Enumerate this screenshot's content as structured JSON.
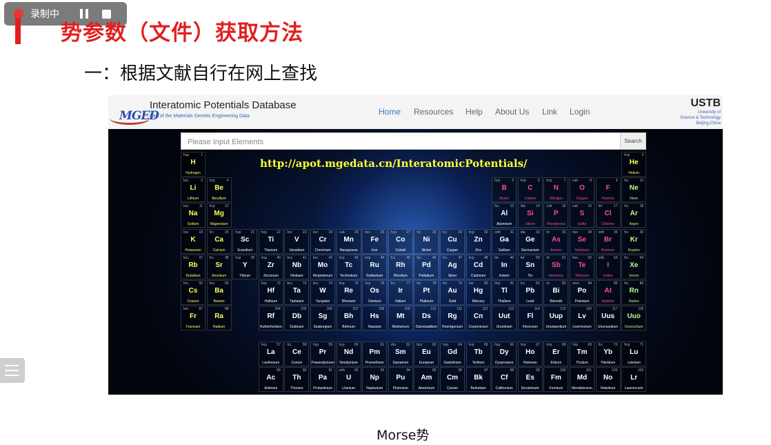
{
  "recorder": {
    "label": "录制中"
  },
  "slide": {
    "title": "势参数（文件）获取方法",
    "subtitle": "一：根据文献自行在网上查找",
    "caption": "Morse势"
  },
  "site": {
    "logo": "MGED",
    "title": "Interatomic Potentials Database",
    "subtitle": "Part of the Materials Genetic Engineering Data",
    "nav": [
      "Home",
      "Resources",
      "Help",
      "About Us",
      "Link",
      "Login"
    ],
    "org": "USTB",
    "org_sub1": "University of",
    "org_sub2": "Science & Technology",
    "org_sub3": "Beijing,China",
    "search_placeholder": "Please Input Elements",
    "search_button": "Search",
    "url": "http://apot.mgedata.cn/InteratomicPotentials/"
  },
  "colors": {
    "accent_red": "#e02020",
    "nav_active": "#3a78c8",
    "url_yellow": "#ffff33"
  },
  "elements": [
    {
      "s": "H",
      "n": "Hydrogen",
      "z": 1,
      "st": "hcp",
      "r": 1,
      "c": 1
    },
    {
      "s": "He",
      "n": "Helium",
      "z": 2,
      "st": "hcp",
      "r": 1,
      "c": 18
    },
    {
      "s": "Li",
      "n": "Lithium",
      "z": 3,
      "st": "bcc",
      "r": 2,
      "c": 1
    },
    {
      "s": "Be",
      "n": "Beryllium",
      "z": 4,
      "st": "hcp",
      "r": 2,
      "c": 2
    },
    {
      "s": "B",
      "n": "Boron",
      "z": 5,
      "st": "hcp",
      "r": 2,
      "c": 13
    },
    {
      "s": "C",
      "n": "Carbon",
      "z": 6,
      "st": "hcp",
      "r": 2,
      "c": 14
    },
    {
      "s": "N",
      "n": "Nitrogen",
      "z": 7,
      "st": "hcp",
      "r": 2,
      "c": 15
    },
    {
      "s": "O",
      "n": "Oxygen",
      "z": 8,
      "st": "cub",
      "r": 2,
      "c": 16
    },
    {
      "s": "F",
      "n": "Fluorine",
      "z": 9,
      "st": "",
      "r": 2,
      "c": 17
    },
    {
      "s": "Ne",
      "n": "Neon",
      "z": 10,
      "st": "fcc",
      "r": 2,
      "c": 18
    },
    {
      "s": "Na",
      "n": "Sodium",
      "z": 11,
      "st": "bcc",
      "r": 3,
      "c": 1
    },
    {
      "s": "Mg",
      "n": "Magnesium",
      "z": 12,
      "st": "hcp",
      "r": 3,
      "c": 2
    },
    {
      "s": "Al",
      "n": "Aluminum",
      "z": 13,
      "st": "fcc",
      "r": 3,
      "c": 13
    },
    {
      "s": "Si",
      "n": "Silicon",
      "z": 14,
      "st": "dia",
      "r": 3,
      "c": 14
    },
    {
      "s": "P",
      "n": "Phosphorus",
      "z": 15,
      "st": "cub",
      "r": 3,
      "c": 15
    },
    {
      "s": "S",
      "n": "Sulfur",
      "z": 16,
      "st": "cub",
      "r": 3,
      "c": 16
    },
    {
      "s": "Cl",
      "n": "Chlorine",
      "z": 17,
      "st": "tet",
      "r": 3,
      "c": 17
    },
    {
      "s": "Ar",
      "n": "Argon",
      "z": 18,
      "st": "fcc",
      "r": 3,
      "c": 18
    },
    {
      "s": "K",
      "n": "Potassium",
      "z": 19,
      "st": "bcc",
      "r": 4,
      "c": 1
    },
    {
      "s": "Ca",
      "n": "Calcium",
      "z": 20,
      "st": "fcc",
      "r": 4,
      "c": 2
    },
    {
      "s": "Sc",
      "n": "Scandium",
      "z": 21,
      "st": "hcp",
      "r": 4,
      "c": 3
    },
    {
      "s": "Ti",
      "n": "Titanium",
      "z": 22,
      "st": "hcp",
      "r": 4,
      "c": 4
    },
    {
      "s": "V",
      "n": "Vanadium",
      "z": 23,
      "st": "bcc",
      "r": 4,
      "c": 5
    },
    {
      "s": "Cr",
      "n": "Chromium",
      "z": 24,
      "st": "bcc",
      "r": 4,
      "c": 6
    },
    {
      "s": "Mn",
      "n": "Manganese",
      "z": 25,
      "st": "cub",
      "r": 4,
      "c": 7
    },
    {
      "s": "Fe",
      "n": "Iron",
      "z": 26,
      "st": "bcc",
      "r": 4,
      "c": 8
    },
    {
      "s": "Co",
      "n": "Cobalt",
      "z": 27,
      "st": "hcp",
      "r": 4,
      "c": 9
    },
    {
      "s": "Ni",
      "n": "Nickel",
      "z": 28,
      "st": "fcc",
      "r": 4,
      "c": 10
    },
    {
      "s": "Cu",
      "n": "Copper",
      "z": 29,
      "st": "fcc",
      "r": 4,
      "c": 11
    },
    {
      "s": "Zn",
      "n": "Zinc",
      "z": 30,
      "st": "hcp",
      "r": 4,
      "c": 12
    },
    {
      "s": "Ga",
      "n": "Gallium",
      "z": 31,
      "st": "orth",
      "r": 4,
      "c": 13
    },
    {
      "s": "Ge",
      "n": "Germanium",
      "z": 32,
      "st": "dia",
      "r": 4,
      "c": 14
    },
    {
      "s": "As",
      "n": "Arsenic",
      "z": 33,
      "st": "tri",
      "r": 4,
      "c": 15
    },
    {
      "s": "Se",
      "n": "Selenium",
      "z": 34,
      "st": "hex",
      "r": 4,
      "c": 16
    },
    {
      "s": "Br",
      "n": "Bromine",
      "z": 35,
      "st": "orth",
      "r": 4,
      "c": 17
    },
    {
      "s": "Kr",
      "n": "Krypton",
      "z": 36,
      "st": "fcc",
      "r": 4,
      "c": 18
    },
    {
      "s": "Rb",
      "n": "Rubidium",
      "z": 37,
      "st": "bcc",
      "r": 5,
      "c": 1
    },
    {
      "s": "Sr",
      "n": "Strontium",
      "z": 38,
      "st": "fcc",
      "r": 5,
      "c": 2
    },
    {
      "s": "Y",
      "n": "Yttrium",
      "z": 39,
      "st": "hcp",
      "r": 5,
      "c": 3
    },
    {
      "s": "Zr",
      "n": "Zirconium",
      "z": 40,
      "st": "hcp",
      "r": 5,
      "c": 4
    },
    {
      "s": "Nb",
      "n": "Niobium",
      "z": 41,
      "st": "bcc",
      "r": 5,
      "c": 5
    },
    {
      "s": "Mo",
      "n": "Molybdenum",
      "z": 42,
      "st": "bcc",
      "r": 5,
      "c": 6
    },
    {
      "s": "Tc",
      "n": "Technetium",
      "z": 43,
      "st": "hcp",
      "r": 5,
      "c": 7
    },
    {
      "s": "Ru",
      "n": "Ruthenium",
      "z": 44,
      "st": "hcp",
      "r": 5,
      "c": 8
    },
    {
      "s": "Rh",
      "n": "Rhodium",
      "z": 45,
      "st": "fcc",
      "r": 5,
      "c": 9
    },
    {
      "s": "Pd",
      "n": "Palladium",
      "z": 46,
      "st": "fcc",
      "r": 5,
      "c": 10
    },
    {
      "s": "Ag",
      "n": "Silver",
      "z": 47,
      "st": "fcc",
      "r": 5,
      "c": 11
    },
    {
      "s": "Cd",
      "n": "Cadmium",
      "z": 48,
      "st": "hcp",
      "r": 5,
      "c": 12
    },
    {
      "s": "In",
      "n": "Indium",
      "z": 49,
      "st": "tet",
      "r": 5,
      "c": 13
    },
    {
      "s": "Sn",
      "n": "Tin",
      "z": 50,
      "st": "tet",
      "r": 5,
      "c": 14
    },
    {
      "s": "Sb",
      "n": "Antimony",
      "z": 51,
      "st": "tri",
      "r": 5,
      "c": 15
    },
    {
      "s": "Te",
      "n": "Tellurium",
      "z": 52,
      "st": "hex",
      "r": 5,
      "c": 16
    },
    {
      "s": "I",
      "n": "Iodine",
      "z": 53,
      "st": "orth",
      "r": 5,
      "c": 17
    },
    {
      "s": "Xe",
      "n": "Xenon",
      "z": 54,
      "st": "fcc",
      "r": 5,
      "c": 18
    },
    {
      "s": "Cs",
      "n": "Cesium",
      "z": 55,
      "st": "bcc",
      "r": 6,
      "c": 1
    },
    {
      "s": "Ba",
      "n": "Barium",
      "z": 56,
      "st": "bcc",
      "r": 6,
      "c": 2
    },
    {
      "s": "Hf",
      "n": "Hafnium",
      "z": 72,
      "st": "hcp",
      "r": 6,
      "c": 4
    },
    {
      "s": "Ta",
      "n": "Tantalum",
      "z": 73,
      "st": "bcc",
      "r": 6,
      "c": 5
    },
    {
      "s": "W",
      "n": "Tungsten",
      "z": 74,
      "st": "bcc",
      "r": 6,
      "c": 6
    },
    {
      "s": "Re",
      "n": "Rhenium",
      "z": 75,
      "st": "hcp",
      "r": 6,
      "c": 7
    },
    {
      "s": "Os",
      "n": "Osmium",
      "z": 76,
      "st": "hcp",
      "r": 6,
      "c": 8
    },
    {
      "s": "Ir",
      "n": "Iridium",
      "z": 77,
      "st": "fcc",
      "r": 6,
      "c": 9
    },
    {
      "s": "Pt",
      "n": "Platinum",
      "z": 78,
      "st": "fcc",
      "r": 6,
      "c": 10
    },
    {
      "s": "Au",
      "n": "Gold",
      "z": 79,
      "st": "fcc",
      "r": 6,
      "c": 11
    },
    {
      "s": "Hg",
      "n": "Mercury",
      "z": 80,
      "st": "rho",
      "r": 6,
      "c": 12
    },
    {
      "s": "Tl",
      "n": "Thallium",
      "z": 81,
      "st": "hcp",
      "r": 6,
      "c": 13
    },
    {
      "s": "Pb",
      "n": "Lead",
      "z": 82,
      "st": "fcc",
      "r": 6,
      "c": 14
    },
    {
      "s": "Bi",
      "n": "Bismuth",
      "z": 83,
      "st": "tri",
      "r": 6,
      "c": 15
    },
    {
      "s": "Po",
      "n": "Polonium",
      "z": 84,
      "st": "mon",
      "r": 6,
      "c": 16
    },
    {
      "s": "At",
      "n": "Astatine",
      "z": 85,
      "st": "",
      "r": 6,
      "c": 17
    },
    {
      "s": "Rn",
      "n": "Radon",
      "z": 86,
      "st": "fcc",
      "r": 6,
      "c": 18
    },
    {
      "s": "Fr",
      "n": "Francium",
      "z": 87,
      "st": "bcc",
      "r": 7,
      "c": 1
    },
    {
      "s": "Ra",
      "n": "Radium",
      "z": 88,
      "st": "",
      "r": 7,
      "c": 2
    },
    {
      "s": "Rf",
      "n": "Rutherfordium",
      "z": 104,
      "st": "",
      "r": 7,
      "c": 4
    },
    {
      "s": "Db",
      "n": "Dubnium",
      "z": 105,
      "st": "",
      "r": 7,
      "c": 5
    },
    {
      "s": "Sg",
      "n": "Seaborgium",
      "z": 106,
      "st": "",
      "r": 7,
      "c": 6
    },
    {
      "s": "Bh",
      "n": "Bohrium",
      "z": 107,
      "st": "",
      "r": 7,
      "c": 7
    },
    {
      "s": "Hs",
      "n": "Hassium",
      "z": 108,
      "st": "",
      "r": 7,
      "c": 8
    },
    {
      "s": "Mt",
      "n": "Meitnerium",
      "z": 109,
      "st": "",
      "r": 7,
      "c": 9
    },
    {
      "s": "Ds",
      "n": "Darmstadtium",
      "z": 110,
      "st": "",
      "r": 7,
      "c": 10
    },
    {
      "s": "Rg",
      "n": "Roentgenium",
      "z": 111,
      "st": "",
      "r": 7,
      "c": 11
    },
    {
      "s": "Cn",
      "n": "Copernicium",
      "z": 112,
      "st": "",
      "r": 7,
      "c": 12
    },
    {
      "s": "Uut",
      "n": "Ununtrium",
      "z": 113,
      "st": "",
      "r": 7,
      "c": 13
    },
    {
      "s": "Fl",
      "n": "Flerovium",
      "z": 114,
      "st": "",
      "r": 7,
      "c": 14
    },
    {
      "s": "Uup",
      "n": "Ununpentium",
      "z": 115,
      "st": "",
      "r": 7,
      "c": 15
    },
    {
      "s": "Lv",
      "n": "Livermorium",
      "z": 116,
      "st": "",
      "r": 7,
      "c": 16
    },
    {
      "s": "Uus",
      "n": "Ununseptium",
      "z": 117,
      "st": "",
      "r": 7,
      "c": 17
    },
    {
      "s": "Uuo",
      "n": "Ununoctium",
      "z": 118,
      "st": "",
      "r": 7,
      "c": 18
    },
    {
      "s": "La",
      "n": "Lanthanum",
      "z": 57,
      "st": "hcp",
      "r": 8,
      "c": 4
    },
    {
      "s": "Ce",
      "n": "Cerium",
      "z": 58,
      "st": "fcc",
      "r": 8,
      "c": 5
    },
    {
      "s": "Pr",
      "n": "Praseodymium",
      "z": 59,
      "st": "hcp",
      "r": 8,
      "c": 6
    },
    {
      "s": "Nd",
      "n": "Neodymium",
      "z": 60,
      "st": "hcp",
      "r": 8,
      "c": 7
    },
    {
      "s": "Pm",
      "n": "Promethium",
      "z": 61,
      "st": "",
      "r": 8,
      "c": 8
    },
    {
      "s": "Sm",
      "n": "Samarium",
      "z": 62,
      "st": "rho",
      "r": 8,
      "c": 9
    },
    {
      "s": "Eu",
      "n": "Europium",
      "z": 63,
      "st": "bcc",
      "r": 8,
      "c": 10
    },
    {
      "s": "Gd",
      "n": "Gadolinium",
      "z": 64,
      "st": "hcp",
      "r": 8,
      "c": 11
    },
    {
      "s": "Tb",
      "n": "Terbium",
      "z": 65,
      "st": "hcp",
      "r": 8,
      "c": 12
    },
    {
      "s": "Dy",
      "n": "Dysprosium",
      "z": 66,
      "st": "hcp",
      "r": 8,
      "c": 13
    },
    {
      "s": "Ho",
      "n": "Holmium",
      "z": 67,
      "st": "hcp",
      "r": 8,
      "c": 14
    },
    {
      "s": "Er",
      "n": "Erbium",
      "z": 68,
      "st": "hcp",
      "r": 8,
      "c": 15
    },
    {
      "s": "Tm",
      "n": "Thulium",
      "z": 69,
      "st": "hcp",
      "r": 8,
      "c": 16
    },
    {
      "s": "Yb",
      "n": "Ytterbium",
      "z": 70,
      "st": "fcc",
      "r": 8,
      "c": 17
    },
    {
      "s": "Lu",
      "n": "Lutetium",
      "z": 71,
      "st": "hcp",
      "r": 8,
      "c": 18
    },
    {
      "s": "Ac",
      "n": "Actinium",
      "z": 89,
      "st": "",
      "r": 9,
      "c": 4
    },
    {
      "s": "Th",
      "n": "Thorium",
      "z": 90,
      "st": "",
      "r": 9,
      "c": 5
    },
    {
      "s": "Pa",
      "n": "Protactinium",
      "z": 91,
      "st": "",
      "r": 9,
      "c": 6
    },
    {
      "s": "U",
      "n": "Uranium",
      "z": 92,
      "st": "orth",
      "r": 9,
      "c": 7
    },
    {
      "s": "Np",
      "n": "Neptunium",
      "z": 93,
      "st": "",
      "r": 9,
      "c": 8
    },
    {
      "s": "Pu",
      "n": "Plutonium",
      "z": 94,
      "st": "",
      "r": 9,
      "c": 9
    },
    {
      "s": "Am",
      "n": "Americium",
      "z": 95,
      "st": "",
      "r": 9,
      "c": 10
    },
    {
      "s": "Cm",
      "n": "Curium",
      "z": 96,
      "st": "",
      "r": 9,
      "c": 11
    },
    {
      "s": "Bk",
      "n": "Berkelium",
      "z": 97,
      "st": "",
      "r": 9,
      "c": 12
    },
    {
      "s": "Cf",
      "n": "Californium",
      "z": 98,
      "st": "",
      "r": 9,
      "c": 13
    },
    {
      "s": "Es",
      "n": "Einsteinium",
      "z": 99,
      "st": "",
      "r": 9,
      "c": 14
    },
    {
      "s": "Fm",
      "n": "Fermium",
      "z": 100,
      "st": "",
      "r": 9,
      "c": 15
    },
    {
      "s": "Md",
      "n": "Mendelevium",
      "z": 101,
      "st": "",
      "r": 9,
      "c": 16
    },
    {
      "s": "No",
      "n": "Nobelium",
      "z": 102,
      "st": "",
      "r": 9,
      "c": 17
    },
    {
      "s": "Lr",
      "n": "Lawrencium",
      "z": 103,
      "st": "",
      "r": 9,
      "c": 18
    }
  ]
}
